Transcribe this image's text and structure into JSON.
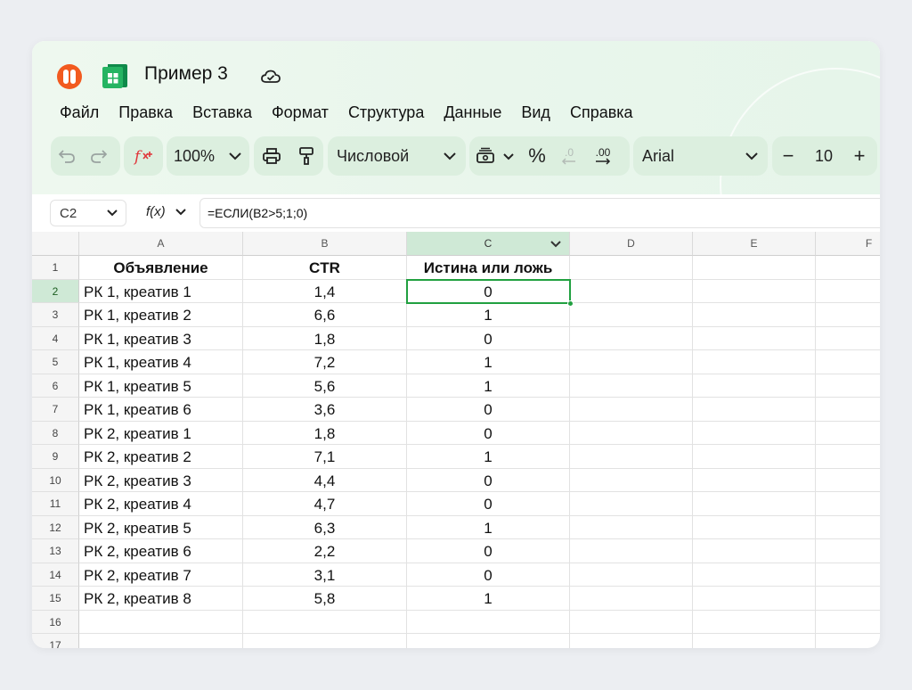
{
  "app": {
    "doc_title": "Пример 3"
  },
  "menu": [
    "Файл",
    "Правка",
    "Вставка",
    "Формат",
    "Структура",
    "Данные",
    "Вид",
    "Справка"
  ],
  "toolbar": {
    "zoom": "100%",
    "number_format": "Числовой",
    "percent": "%",
    "dec_less": ".0",
    "dec_more": ".00",
    "font": "Arial",
    "font_size": "10",
    "minus": "−",
    "plus": "+"
  },
  "formula_bar": {
    "cell_ref": "C2",
    "fx": "f(x)",
    "formula": "=ЕСЛИ(B2>5;1;0)"
  },
  "colors": {
    "accent": "#21a040",
    "selected_header": "#cfe9d6",
    "toolbar_bg": "#dcefdf"
  },
  "columns": [
    "A",
    "B",
    "C",
    "D",
    "E",
    "F"
  ],
  "rows": [
    "1",
    "2",
    "3",
    "4",
    "5",
    "6",
    "7",
    "8",
    "9",
    "10",
    "11",
    "12",
    "13",
    "14",
    "15",
    "16",
    "17"
  ],
  "selected": {
    "col": "C",
    "row": "2"
  },
  "header_row": [
    "Объявление",
    "CTR",
    "Истина или ложь"
  ],
  "data_rows": [
    [
      "РК 1, креатив 1",
      "1,4",
      "0"
    ],
    [
      "РК 1, креатив 2",
      "6,6",
      "1"
    ],
    [
      "РК 1, креатив 3",
      "1,8",
      "0"
    ],
    [
      "РК 1, креатив 4",
      "7,2",
      "1"
    ],
    [
      "РК 1, креатив 5",
      "5,6",
      "1"
    ],
    [
      "РК 1, креатив 6",
      "3,6",
      "0"
    ],
    [
      "РК 2, креатив 1",
      "1,8",
      "0"
    ],
    [
      "РК 2, креатив 2",
      "7,1",
      "1"
    ],
    [
      "РК 2, креатив 3",
      "4,4",
      "0"
    ],
    [
      "РК 2, креатив 4",
      "4,7",
      "0"
    ],
    [
      "РК 2, креатив 5",
      "6,3",
      "1"
    ],
    [
      "РК 2, креатив 6",
      "2,2",
      "0"
    ],
    [
      "РК 2, креатив 7",
      "3,1",
      "0"
    ],
    [
      "РК 2, креатив 8",
      "5,8",
      "1"
    ]
  ]
}
